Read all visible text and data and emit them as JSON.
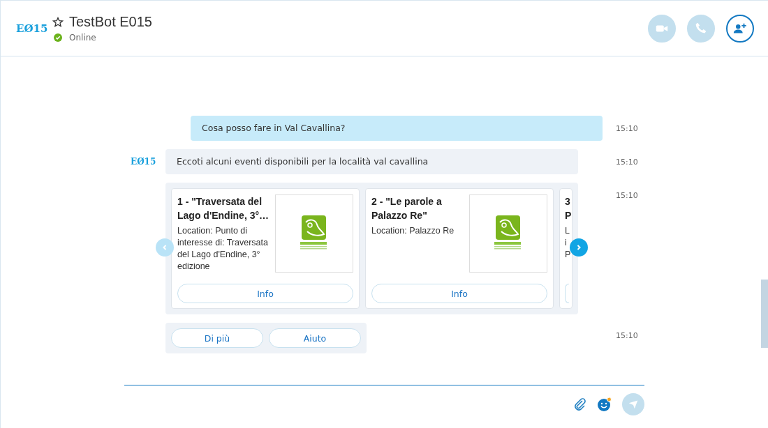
{
  "header": {
    "logo": "EØ15",
    "favorite": false,
    "title": "TestBot E015",
    "status": "Online",
    "online": true
  },
  "actions": [
    {
      "kind": "video",
      "disabled": true
    },
    {
      "kind": "call",
      "disabled": true
    },
    {
      "kind": "add-person",
      "disabled": false
    }
  ],
  "messages": [
    {
      "kind": "user",
      "text": "Cosa posso fare in Val Cavallina?",
      "time": "15:10"
    },
    {
      "kind": "bot",
      "avatar": "EØ15",
      "text": "Eccoti alcuni eventi disponibili per la località val cavallina",
      "time": "15:10"
    },
    {
      "kind": "carousel",
      "time": "15:10",
      "cards": [
        {
          "title_lines": [
            "1 - \"Traversata del",
            "Lago d'Endine, 3°…"
          ],
          "description_lines": [
            "Location: Punto di",
            "interesse di: Traversata",
            "del Lago d'Endine, 3°",
            "edizione"
          ],
          "button": "Info",
          "partial": false
        },
        {
          "title_lines": [
            "2 - \"Le parole a",
            "Palazzo Re\""
          ],
          "description_lines": [
            "Location: Palazzo Re"
          ],
          "button": "Info",
          "partial": false
        },
        {
          "title_lines": [
            "3",
            "P"
          ],
          "description_lines": [
            "L",
            "i",
            "P"
          ],
          "partial": true
        }
      ]
    },
    {
      "kind": "suggestions",
      "time": "15:10",
      "buttons": [
        "Di più",
        "Aiuto"
      ]
    }
  ]
}
